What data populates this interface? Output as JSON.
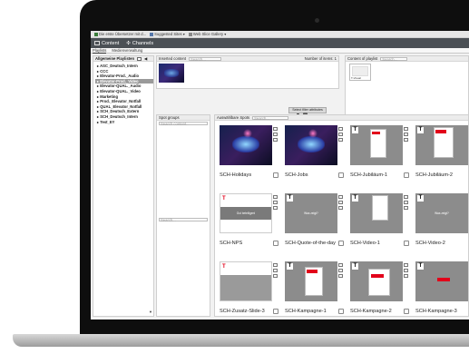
{
  "browser": {
    "tabs": [
      {
        "label": "Die erste Übersetzer mit d..."
      },
      {
        "label": "Suggested Sites ▾"
      },
      {
        "label": "Web Slice Gallery ▾"
      }
    ]
  },
  "header": {
    "content_label": "Content",
    "channels_label": "Channels"
  },
  "subtabs": {
    "items": [
      {
        "label": "Playlists"
      },
      {
        "label": "Medienverwaltung"
      }
    ]
  },
  "playlists": {
    "title": "Allgemeine Playlisten",
    "items": [
      {
        "label": "ASC_Deutsch_Intern"
      },
      {
        "label": "CCC"
      },
      {
        "label": "Elevator-Prod._Audio"
      },
      {
        "label": "Elevator-Prod._Video"
      },
      {
        "label": "Elevator-QUAL._Audio"
      },
      {
        "label": "Elevator-QUAL._Video"
      },
      {
        "label": "Marketing"
      },
      {
        "label": "Prod._Elevator_Notfall"
      },
      {
        "label": "QUAL_Elevator_Notfall"
      },
      {
        "label": "SCH_Deutsch_Extern"
      },
      {
        "label": "SCH_Deutsch_Intern"
      },
      {
        "label": "Test_EY"
      }
    ],
    "selected_index": 3
  },
  "inserted": {
    "label": "Inserted content",
    "search_placeholder": "Search...",
    "count_label": "Number of items: 1"
  },
  "playlist_content": {
    "label": "Content of playlist",
    "search_placeholder": "Search...",
    "thumb_caption": "T-Visual"
  },
  "spot_groups": {
    "title": "Spot groups",
    "search_placeholder": "Search content...",
    "bottom_search_placeholder": "Search..."
  },
  "spots": {
    "title": "Auswählbare Spots",
    "search_placeholder": "Search...",
    "filter_label": "Select filter attributes",
    "cards": [
      {
        "name": "SCH-Holidays",
        "style": "vr"
      },
      {
        "name": "SCH-Jobs",
        "style": "vr"
      },
      {
        "name": "SCH-Jubiläum-1",
        "style": "doc"
      },
      {
        "name": "SCH-Jubiläum-2",
        "style": "doc"
      },
      {
        "name": "SCH-NPS",
        "style": "nps",
        "banner": "Gut beteiligen!"
      },
      {
        "name": "SCH-Quote-of-the-day",
        "style": "grey",
        "banner": "Was zeigt?"
      },
      {
        "name": "SCH-Video-1",
        "style": "doc"
      },
      {
        "name": "SCH-Video-2",
        "style": "grey",
        "banner": "Was zeigt?"
      },
      {
        "name": "SCH-Zusatz-Slide-3",
        "style": "nps-light"
      },
      {
        "name": "SCH-Kampagne-1",
        "style": "camp"
      },
      {
        "name": "SCH-Kampagne-2",
        "style": "camp2"
      },
      {
        "name": "SCH-Kampagne-3",
        "style": "camp3"
      }
    ],
    "brand_red": "#e2001a"
  }
}
